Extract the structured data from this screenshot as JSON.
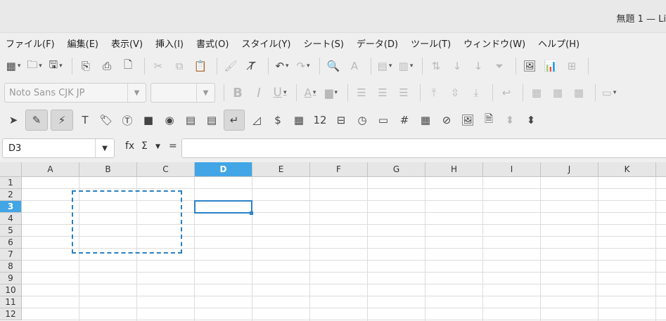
{
  "window": {
    "title": "無題 1 — Li"
  },
  "menu": [
    "ファイル(F)",
    "編集(E)",
    "表示(V)",
    "挿入(I)",
    "書式(O)",
    "スタイル(Y)",
    "シート(S)",
    "データ(D)",
    "ツール(T)",
    "ウィンドウ(W)",
    "ヘルプ(H)"
  ],
  "toolbar_format": {
    "font_name": "Noto Sans CJK JP",
    "font_size": ""
  },
  "formula_bar": {
    "cell_ref": "D3",
    "fx_label": "fx",
    "sum_label": "Σ",
    "equals_label": "=",
    "content": ""
  },
  "sheet": {
    "columns": [
      "A",
      "B",
      "C",
      "D",
      "E",
      "F",
      "G",
      "H",
      "I",
      "J",
      "K"
    ],
    "rows": [
      "1",
      "2",
      "3",
      "4",
      "5",
      "6",
      "7",
      "8",
      "9",
      "10",
      "11",
      "12"
    ],
    "selected_column": "D",
    "selected_row": "3"
  },
  "toolbar_misc": {
    "number_label": "12"
  },
  "colors": {
    "selection": "#42a6e6",
    "accent": "#2a82c9"
  }
}
